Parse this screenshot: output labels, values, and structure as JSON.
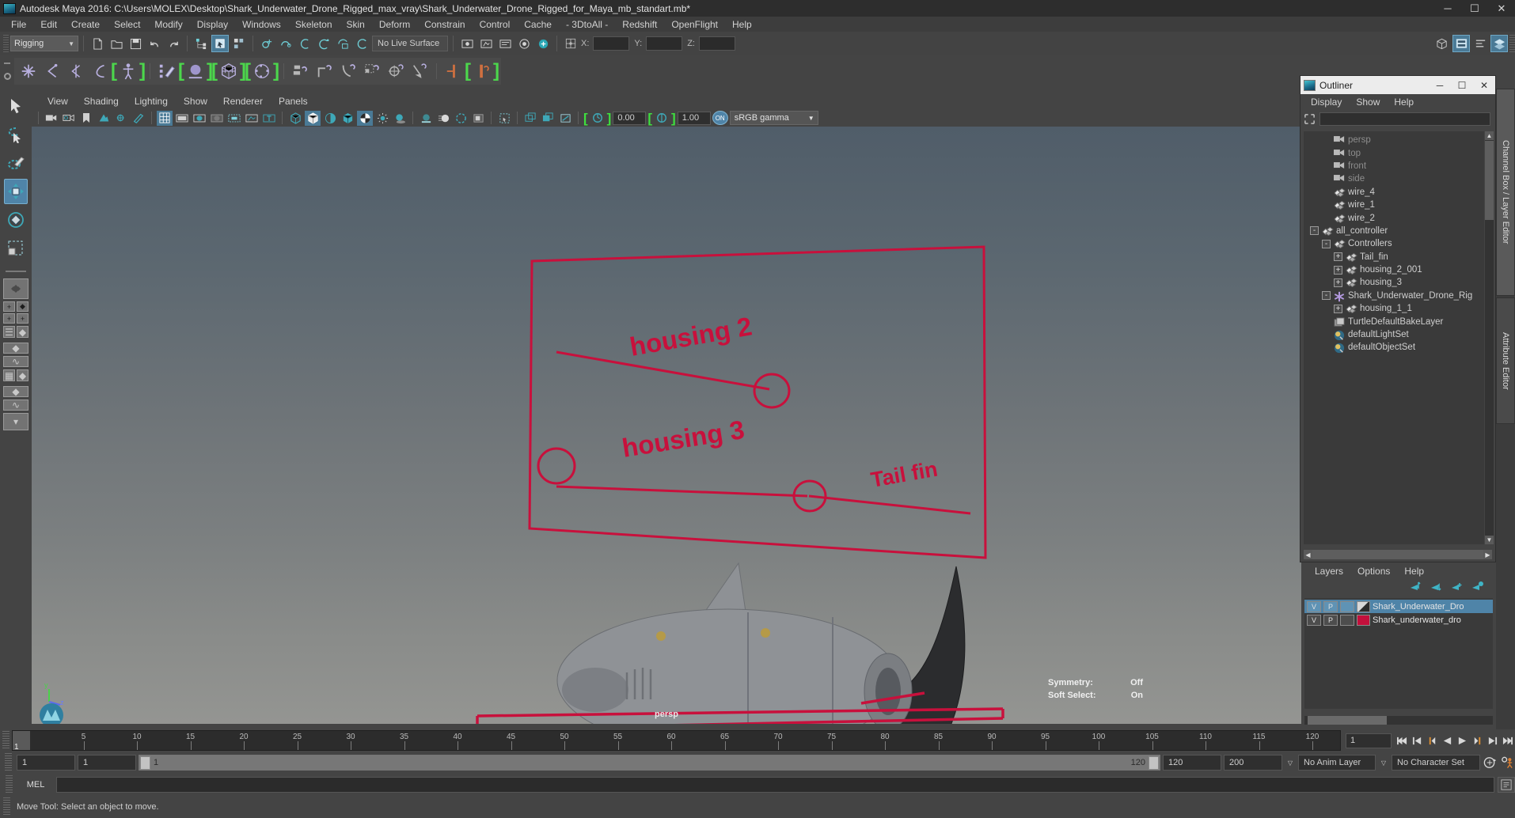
{
  "window": {
    "title": "Autodesk Maya 2016: C:\\Users\\MOLEX\\Desktop\\Shark_Underwater_Drone_Rigged_max_vray\\Shark_Underwater_Drone_Rigged_for_Maya_mb_standart.mb*",
    "minimize": "─",
    "maximize": "☐",
    "close": "✕"
  },
  "menu": {
    "items": [
      "File",
      "Edit",
      "Create",
      "Select",
      "Modify",
      "Display",
      "Windows",
      "Skeleton",
      "Skin",
      "Deform",
      "Constrain",
      "Control",
      "Cache",
      "- 3DtoAll -",
      "Redshift",
      "OpenFlight",
      "Help"
    ]
  },
  "status_toolbar": {
    "mode": "Rigging",
    "live_surface": "No Live Surface",
    "coord_x_label": "X:",
    "coord_y_label": "Y:",
    "coord_z_label": "Z:",
    "coord_x_value": "",
    "coord_y_value": "",
    "coord_z_value": ""
  },
  "viewport": {
    "menu": [
      "View",
      "Shading",
      "Lighting",
      "Show",
      "Renderer",
      "Panels"
    ],
    "exposure_value": "0.00",
    "gamma_value": "1.00",
    "color_profile": "sRGB gamma",
    "on_badge": "ON",
    "camera_label": "persp",
    "symmetry_label": "Symmetry:",
    "symmetry_value": "Off",
    "soft_select_label": "Soft Select:",
    "soft_select_value": "On",
    "annotations": [
      {
        "text": "housing 2"
      },
      {
        "text": "housing 3"
      },
      {
        "text": "Tail fin"
      }
    ],
    "annotation_color": "#c8103c"
  },
  "outliner": {
    "window_title": "Outliner",
    "minimize": "─",
    "maximize": "☐",
    "close": "✕",
    "menu": [
      "Display",
      "Show",
      "Help"
    ],
    "search_value": "",
    "tree": [
      {
        "label": "persp",
        "indent": 1,
        "expander": "",
        "icon": "camera-icon",
        "dim": true
      },
      {
        "label": "top",
        "indent": 1,
        "expander": "",
        "icon": "camera-icon",
        "dim": true
      },
      {
        "label": "front",
        "indent": 1,
        "expander": "",
        "icon": "camera-icon",
        "dim": true
      },
      {
        "label": "side",
        "indent": 1,
        "expander": "",
        "icon": "camera-icon",
        "dim": true
      },
      {
        "label": "wire_4",
        "indent": 1,
        "expander": "",
        "icon": "transform-icon",
        "dim": false
      },
      {
        "label": "wire_1",
        "indent": 1,
        "expander": "",
        "icon": "transform-icon",
        "dim": false
      },
      {
        "label": "wire_2",
        "indent": 1,
        "expander": "",
        "icon": "transform-icon",
        "dim": false
      },
      {
        "label": "all_controller",
        "indent": 0,
        "expander": "-",
        "icon": "transform-icon",
        "dim": false
      },
      {
        "label": "Controllers",
        "indent": 1,
        "expander": "-",
        "icon": "transform-icon",
        "dim": false
      },
      {
        "label": "Tail_fin",
        "indent": 2,
        "expander": "+",
        "icon": "transform-icon",
        "dim": false
      },
      {
        "label": "housing_2_001",
        "indent": 2,
        "expander": "+",
        "icon": "transform-icon",
        "dim": false
      },
      {
        "label": "housing_3",
        "indent": 2,
        "expander": "+",
        "icon": "transform-icon",
        "dim": false
      },
      {
        "label": "Shark_Underwater_Drone_Rig",
        "indent": 1,
        "expander": "-",
        "icon": "star-icon",
        "dim": false
      },
      {
        "label": "housing_1_1",
        "indent": 2,
        "expander": "+",
        "icon": "transform-icon",
        "dim": false
      },
      {
        "label": "TurtleDefaultBakeLayer",
        "indent": 1,
        "expander": "",
        "icon": "layer-icon",
        "dim": false
      },
      {
        "label": "defaultLightSet",
        "indent": 1,
        "expander": "",
        "icon": "set-icon",
        "dim": false
      },
      {
        "label": "defaultObjectSet",
        "indent": 1,
        "expander": "",
        "icon": "set-icon",
        "dim": false
      }
    ]
  },
  "layer_editor": {
    "menu": [
      "Layers",
      "Options",
      "Help"
    ],
    "col_v": "V",
    "col_p": "P",
    "layers": [
      {
        "v": "V",
        "p": "P",
        "t": "",
        "name": "Shark_Underwater_Dro",
        "color": "#2b2b2b",
        "selected": true
      },
      {
        "v": "V",
        "p": "P",
        "t": "",
        "name": "Shark_underwater_dro",
        "color": "#c4103c",
        "selected": false
      }
    ]
  },
  "side_tabs": {
    "channel_box": "Channel Box / Layer Editor",
    "attribute_editor": "Attribute Editor"
  },
  "timeline": {
    "ticks": [
      "5",
      "10",
      "15",
      "20",
      "25",
      "30",
      "35",
      "40",
      "45",
      "50",
      "55",
      "60",
      "65",
      "70",
      "75",
      "80",
      "85",
      "90",
      "95",
      "100",
      "105",
      "110",
      "115",
      "120"
    ],
    "current_frame": "1",
    "current_frame_field": "1",
    "start_field": "1",
    "range_start_field": "1",
    "range_slider_start": "1",
    "range_slider_end": "120",
    "end_field": "120",
    "playback_end_field": "200",
    "anim_layer": "No Anim Layer",
    "character_set": "No Character Set"
  },
  "mel": {
    "label": "MEL",
    "command_value": ""
  },
  "statusbar": {
    "message": "Move Tool: Select an object to move."
  }
}
